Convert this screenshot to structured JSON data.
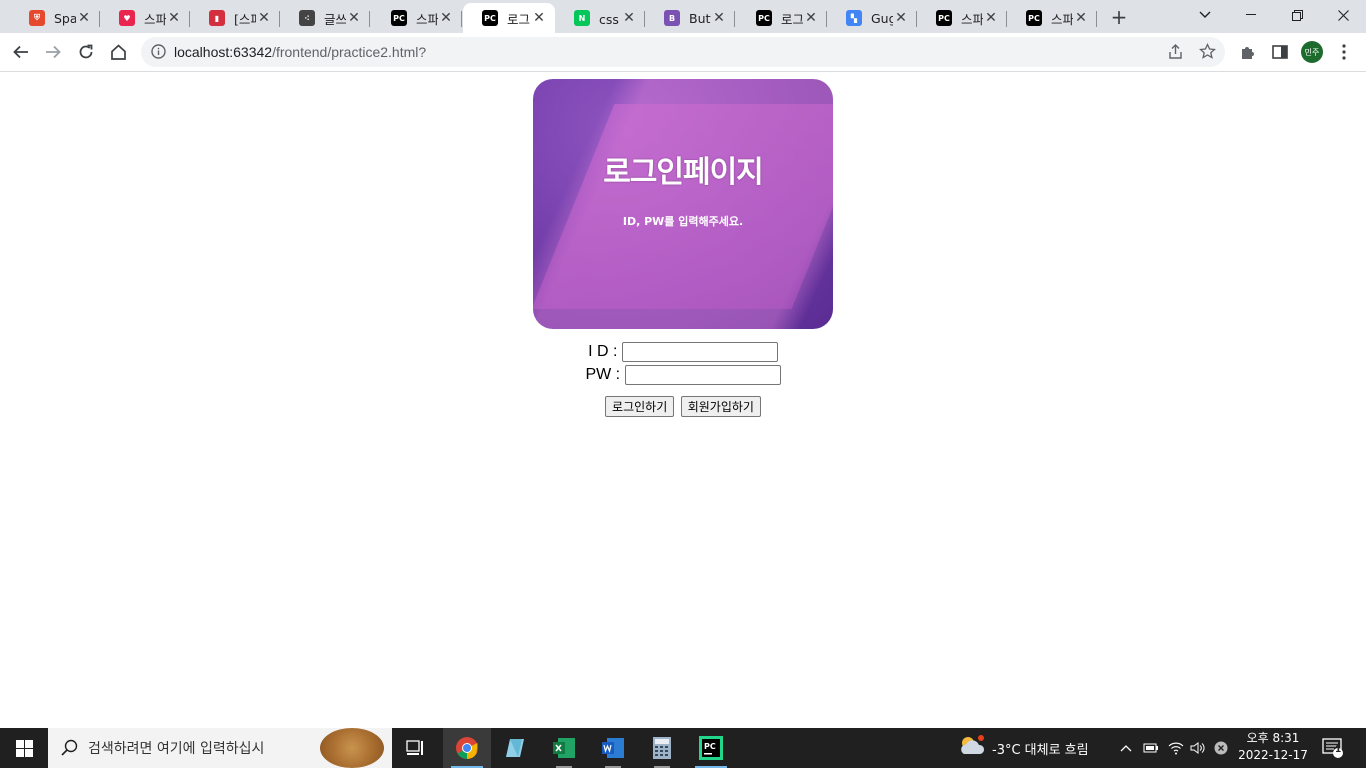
{
  "browser": {
    "tabs": [
      {
        "title": "Sparta",
        "favicon_color": "#e64a2e",
        "favicon_glyph": "⛨"
      },
      {
        "title": "스파르",
        "favicon_color": "#e8244f",
        "favicon_glyph": "♥"
      },
      {
        "title": "[스파",
        "favicon_color": "#d32f3f",
        "favicon_glyph": "▮"
      },
      {
        "title": "글쓰",
        "favicon_color": "#444444",
        "favicon_glyph": "⁖"
      },
      {
        "title": "스파르",
        "favicon_color": "#000000",
        "favicon_glyph": "PC"
      },
      {
        "title": "로그",
        "favicon_color": "#000000",
        "favicon_glyph": "PC",
        "active": true
      },
      {
        "title": "css 구",
        "favicon_color": "#03c75a",
        "favicon_glyph": "N"
      },
      {
        "title": "Butto",
        "favicon_color": "#7952b3",
        "favicon_glyph": "B"
      },
      {
        "title": "로그",
        "favicon_color": "#000000",
        "favicon_glyph": "PC"
      },
      {
        "title": "Gugl",
        "favicon_color": "#4285f4",
        "favicon_glyph": "▚"
      },
      {
        "title": "스파르",
        "favicon_color": "#000000",
        "favicon_glyph": "PC"
      },
      {
        "title": "스파르",
        "favicon_color": "#000000",
        "favicon_glyph": "PC"
      }
    ],
    "url_host": "localhost:63342",
    "url_path": "/frontend/practice2.html?",
    "profile_initials": "민주"
  },
  "page": {
    "banner_title": "로그인페이지",
    "banner_subtitle": "ID, PW를 입력해주세요.",
    "id_label": "I D :",
    "pw_label": "PW :",
    "id_value": "",
    "pw_value": "",
    "login_button": "로그인하기",
    "signup_button": "회원가입하기"
  },
  "taskbar": {
    "search_placeholder": "검색하려면 여기에 입력하십시",
    "weather": "-3°C  대체로 흐림",
    "time": "오후 8:31",
    "date": "2022-12-17",
    "notification_count": "1"
  }
}
